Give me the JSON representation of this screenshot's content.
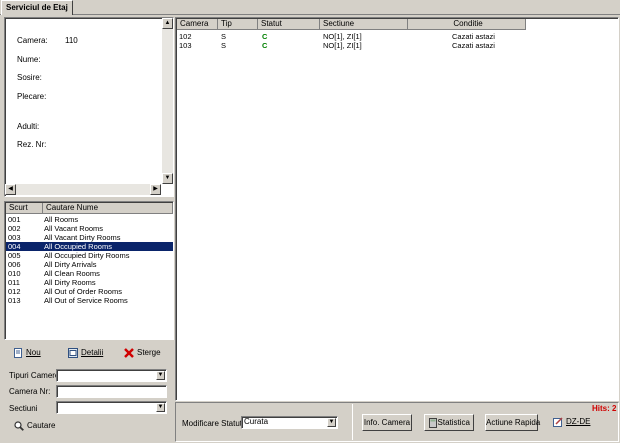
{
  "tab": {
    "label": "Serviciul de Etaj"
  },
  "info": {
    "camera_label": "Camera:",
    "camera_value": "110",
    "nume_label": "Nume:",
    "sosire_label": "Sosire:",
    "plecare_label": "Plecare:",
    "adulti_label": "Adulti:",
    "rez_label": "Rez. Nr:"
  },
  "searches": {
    "headers": [
      "Scurt",
      "Cautare Nume"
    ],
    "rows": [
      {
        "code": "001",
        "name": "All Rooms"
      },
      {
        "code": "002",
        "name": "All Vacant Rooms"
      },
      {
        "code": "003",
        "name": "All Vacant Dirty Rooms"
      },
      {
        "code": "004",
        "name": "All Occupied Rooms"
      },
      {
        "code": "005",
        "name": "All Occupied Dirty Rooms"
      },
      {
        "code": "006",
        "name": "All Dirty Arrivals"
      },
      {
        "code": "010",
        "name": "All Clean Rooms"
      },
      {
        "code": "011",
        "name": "All Dirty Rooms"
      },
      {
        "code": "012",
        "name": "All Out of Order Rooms"
      },
      {
        "code": "013",
        "name": "All Out of Service Rooms"
      }
    ],
    "selected_index": 3
  },
  "actions": {
    "nou": "Nou",
    "detalii": "Detalii",
    "sterge": "Sterge"
  },
  "filters": {
    "tipuri_label": "Tipuri Camere",
    "tipuri_value": "",
    "camera_label": "Camera Nr:",
    "camera_value": "",
    "sectiuni_label": "Sectiuni",
    "sectiuni_value": "",
    "cautare": "Cautare"
  },
  "rooms": {
    "headers": [
      "Camera",
      "Tip",
      "Statut",
      "Sectiune",
      "Conditie"
    ],
    "rows": [
      {
        "camera": "102",
        "tip": "S",
        "statut": "C",
        "sectiune": "NO[1], ZI[1]",
        "conditie": "Cazati astazi"
      },
      {
        "camera": "103",
        "tip": "S",
        "statut": "C",
        "sectiune": "NO[1], ZI[1]",
        "conditie": "Cazati astazi"
      }
    ]
  },
  "bottom": {
    "modificare_label": "Modificare Statut",
    "statut_value": "Curata",
    "info_camera": "Info. Camera",
    "statistica": "Statistica",
    "actiune_rapida": "Actiune Rapida",
    "dz_de": "DZ-DE",
    "hits": "Hits: 2"
  },
  "colors": {
    "selection": "#0a246a",
    "status_green": "#008000",
    "hits_red": "#d00000"
  }
}
